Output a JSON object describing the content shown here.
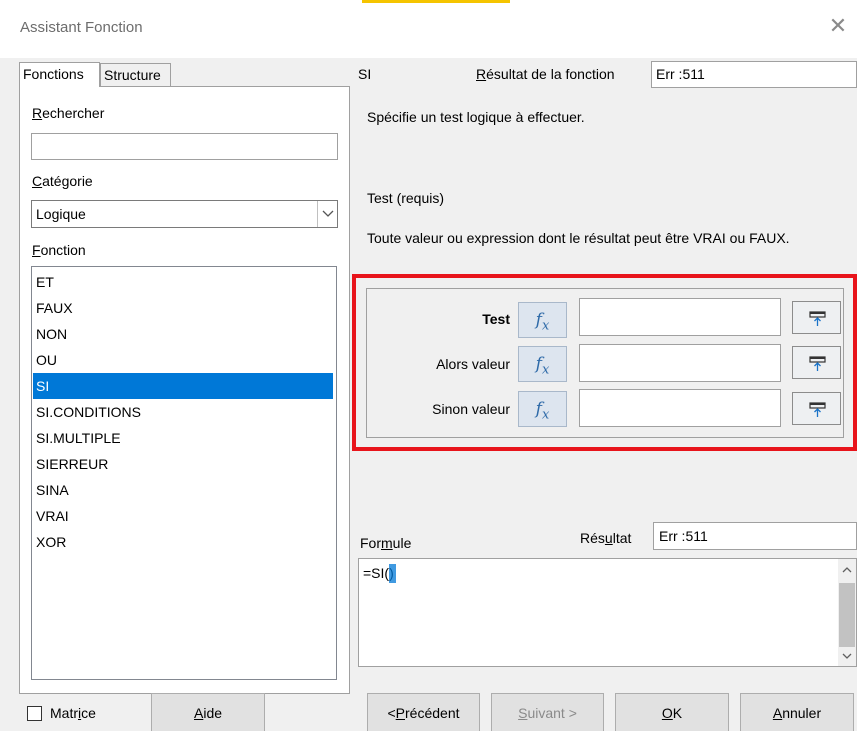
{
  "dialog": {
    "title": "Assistant Fonction",
    "close_glyph": "✕"
  },
  "tabs": {
    "functions": "Fonctions",
    "structure": "Structure"
  },
  "left": {
    "search_label": "Rechercher",
    "search_value": "",
    "category_label": "Catégorie",
    "category_value": "Logique",
    "function_label": "Fonction",
    "functions": [
      "ET",
      "FAUX",
      "NON",
      "OU",
      "SI",
      "SI.CONDITIONS",
      "SI.MULTIPLE",
      "SIERREUR",
      "SINA",
      "VRAI",
      "XOR"
    ],
    "selected_function": "SI"
  },
  "right": {
    "function_name": "SI",
    "result_label": "Résultat de la fonction",
    "result_value": "Err :511",
    "description": "Spécifie un test logique à effectuer.",
    "param_title": "Test (requis)",
    "param_description": "Toute valeur ou expression dont le résultat peut être VRAI ou FAUX.",
    "args": [
      {
        "label": "Test",
        "value": "",
        "bold": true
      },
      {
        "label": "Alors valeur",
        "value": "",
        "bold": false
      },
      {
        "label": "Sinon valeur",
        "value": "",
        "bold": false
      }
    ],
    "formula_label": "Formule",
    "formula_result_label": "Résultat",
    "formula_result_value": "Err :511",
    "formula_value": "=SI()"
  },
  "footer": {
    "matrix_label": "Matrice",
    "matrix_checked": false,
    "help": "Aide",
    "previous": "<Précédent",
    "next": "Suivant >",
    "ok": "OK",
    "cancel": "Annuler"
  },
  "colors": {
    "selection": "#0078d7",
    "highlight_border": "#e8141b",
    "fx_button": "#dde5ef"
  },
  "icons": {
    "fx": "fx-function-icon",
    "shrink": "shrink-collapse-icon",
    "dropdown": "chevron-down-icon",
    "close": "close-icon"
  }
}
